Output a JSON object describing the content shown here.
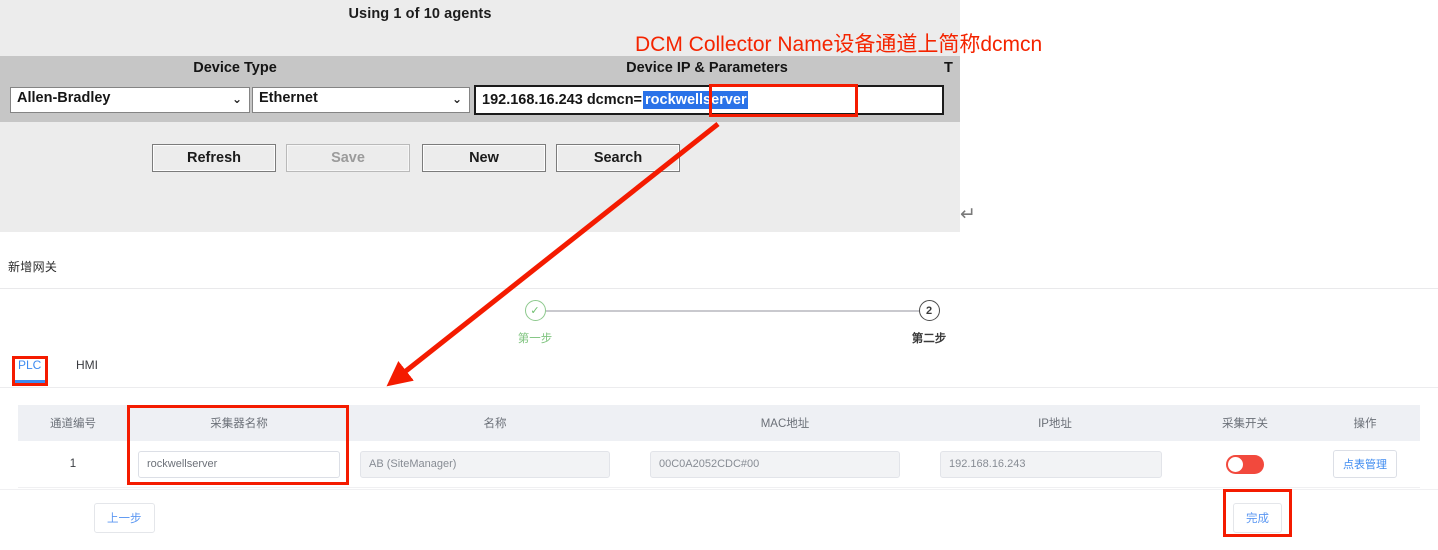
{
  "legacy_panel": {
    "agents_status": "Using 1 of 10 agents",
    "headers": {
      "device_type": "Device Type",
      "device_ip_params": "Device IP & Parameters",
      "test": "T"
    },
    "device_vendor": "Allen-Bradley",
    "device_protocol": "Ethernet",
    "caret_glyph": "⌄",
    "ip_parameters_prefix": "192.168.16.243 dcmcn=",
    "ip_parameters_selected": "rockwellserver",
    "buttons": {
      "refresh": "Refresh",
      "save": "Save",
      "new": "New",
      "search": "Search"
    },
    "enter_glyph": "↵"
  },
  "annotation": {
    "text": "DCM Collector Name设备通道上简称dcmcn",
    "color": "#f42400"
  },
  "web_app": {
    "page_title": "新增网关",
    "steps": [
      {
        "label": "第一步",
        "marker": "✓",
        "state": "completed"
      },
      {
        "label": "第二步",
        "marker": "2",
        "state": "active"
      }
    ],
    "tabs": [
      {
        "label": "PLC",
        "active": true
      },
      {
        "label": "HMI",
        "active": false
      }
    ],
    "table": {
      "headers": [
        "通道编号",
        "采集器名称",
        "名称",
        "MAC地址",
        "IP地址",
        "采集开关",
        "操作"
      ],
      "rows": [
        {
          "channel": "1",
          "collector_name": "rockwellserver",
          "name": "AB (SiteManager)",
          "mac": "00C0A2052CDC#00",
          "ip": "192.168.16.243",
          "collect_switch_on": false,
          "action_label": "点表管理"
        }
      ]
    },
    "footer": {
      "prev": "上一步",
      "finish": "完成"
    },
    "colors": {
      "accent": "#3e8bf0",
      "toggle_off": "#f2493d",
      "step_done": "#7fc47f",
      "highlight_box": "#f41b00",
      "selection_blue": "#2a72e8"
    }
  }
}
